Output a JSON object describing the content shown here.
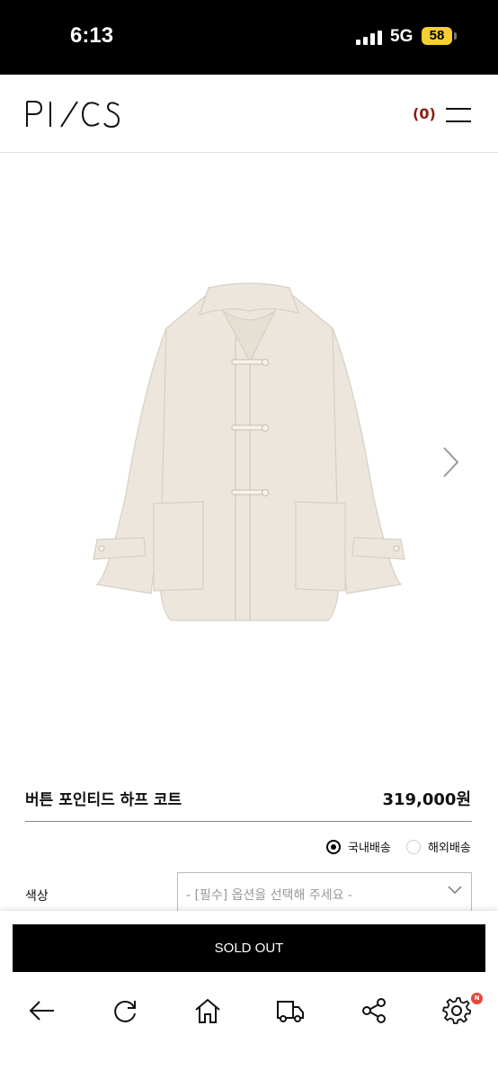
{
  "status_bar": {
    "time": "6:13",
    "network": "5G",
    "battery": "58"
  },
  "header": {
    "logo_text": "PI/CS",
    "cart_label": "(0)"
  },
  "product": {
    "title": "버튼 포인티드 하프 코트",
    "price": "319,000원",
    "image_alt": "ivory half coat with toggle buttons"
  },
  "shipping": {
    "domestic_label": "국내배송",
    "overseas_label": "해외배송",
    "selected": "domestic"
  },
  "options": {
    "color_label": "색상",
    "color_select_placeholder": "- [필수] 옵션을 선택해 주세요 -"
  },
  "actions": {
    "sold_out_label": "SOLD OUT"
  },
  "bottom_nav": {
    "items": [
      "back-icon",
      "refresh-icon",
      "home-icon",
      "delivery-truck-icon",
      "share-icon",
      "settings-icon"
    ],
    "settings_badge": "N"
  },
  "colors": {
    "cart_accent": "#8a1c12",
    "battery": "#f5d02f",
    "badge": "#e8463a",
    "coat": "#ece6dd"
  }
}
